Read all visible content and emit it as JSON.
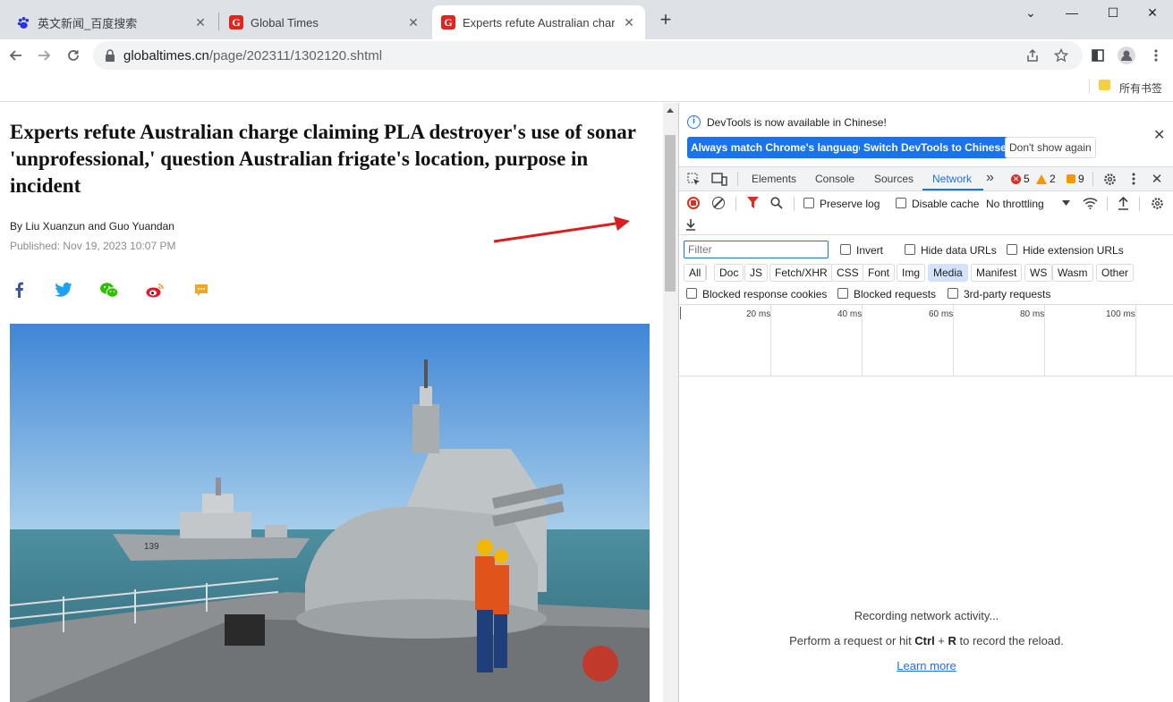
{
  "browser": {
    "tabs": [
      {
        "title": "英文新闻_百度搜索",
        "icon": "baidu-paw-icon",
        "active": false
      },
      {
        "title": "Global Times",
        "icon": "global-times-g-icon",
        "active": false
      },
      {
        "title": "Experts refute Australian charge",
        "icon": "global-times-g-icon",
        "active": true
      }
    ],
    "favicon_letter": "G",
    "new_tab": "+",
    "window_controls": {
      "menu": "⌄",
      "minimize": "—",
      "maximize": "☐",
      "close": "✕"
    },
    "url_domain": "globaltimes.cn",
    "url_path": "/page/202311/1302120.shtml",
    "bookmark_label": "所有书签"
  },
  "article": {
    "headline": "Experts refute Australian charge claiming PLA destroyer's use of sonar 'unprofessional,' question Australian frigate's location, purpose in incident",
    "byline": "By Liu Xuanzun and Guo Yuandan",
    "published": "Published: Nov 19, 2023 10:07 PM",
    "hull_number": "139",
    "share_icons": [
      "facebook-icon",
      "twitter-icon",
      "wechat-icon",
      "weibo-icon",
      "comment-icon"
    ]
  },
  "devtools": {
    "banner_text": "DevTools is now available in Chinese!",
    "banner_buttons": [
      "Always match Chrome's language",
      "Switch DevTools to Chinese",
      "Don't show again"
    ],
    "tabs": [
      "Elements",
      "Console",
      "Sources",
      "Network"
    ],
    "active_tab": "Network",
    "more_tabs": "»",
    "counts": {
      "errors": "5",
      "warnings": "2",
      "info": "9"
    },
    "preserve_log": "Preserve log",
    "disable_cache": "Disable cache",
    "throttling": "No throttling",
    "filter_placeholder": "Filter",
    "invert": "Invert",
    "hide_data_urls": "Hide data URLs",
    "hide_extension_urls": "Hide extension URLs",
    "type_filters": [
      "All",
      "Doc",
      "JS",
      "Fetch/XHR",
      "CSS",
      "Font",
      "Img",
      "Media",
      "Manifest",
      "WS",
      "Wasm",
      "Other"
    ],
    "active_type": "Media",
    "blocked_response_cookies": "Blocked response cookies",
    "blocked_requests": "Blocked requests",
    "third_party_requests": "3rd-party requests",
    "timeline_ticks": [
      "20 ms",
      "40 ms",
      "60 ms",
      "80 ms",
      "100 ms"
    ],
    "empty_line1": "Recording network activity...",
    "empty_line2_pre": "Perform a request or hit ",
    "empty_key1": "Ctrl",
    "empty_plus": " + ",
    "empty_key2": "R",
    "empty_line2_post": " to record the reload.",
    "learn_more": "Learn more"
  },
  "colors": {
    "accent": "#1a73e8",
    "brand_red": "#e1251b",
    "error": "#d93025",
    "warning": "#f29900"
  }
}
